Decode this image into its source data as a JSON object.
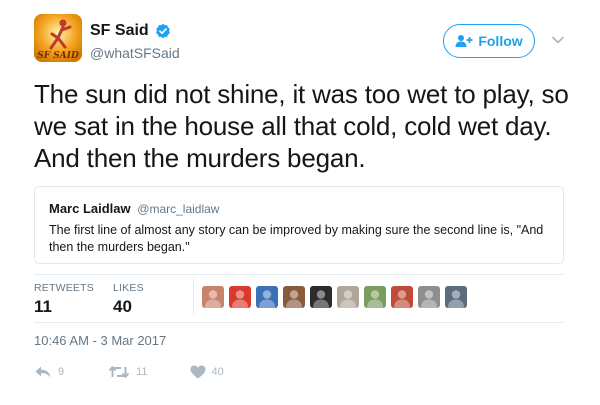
{
  "author": {
    "name": "SF Said",
    "handle": "@whatSFSaid",
    "avatar_text": "SF SAID"
  },
  "follow_button": {
    "label": "Follow"
  },
  "tweet": {
    "text": "The sun did not shine, it was too wet to play, so\nwe sat in the house all that cold, cold wet day.\nAnd then the murders began."
  },
  "quoted_tweet": {
    "author_name": "Marc Laidlaw",
    "author_handle": "@marc_laidlaw",
    "text": "The first line of almost any story can be improved by making sure the second line is, \"And then the murders began.\""
  },
  "stats": {
    "retweets_label": "RETWEETS",
    "retweets_value": "11",
    "likes_label": "LIKES",
    "likes_value": "40"
  },
  "likers": [
    {
      "name": "liker-1-avatar",
      "color": "#c9836b"
    },
    {
      "name": "liker-2-avatar",
      "color": "#d93a2b"
    },
    {
      "name": "liker-3-avatar",
      "color": "#3b6fb6"
    },
    {
      "name": "liker-4-avatar",
      "color": "#8a5a3c"
    },
    {
      "name": "liker-5-avatar",
      "color": "#2c2c2c"
    },
    {
      "name": "liker-6-avatar",
      "color": "#b0a79c"
    },
    {
      "name": "liker-7-avatar",
      "color": "#7a9c5e"
    },
    {
      "name": "liker-8-avatar",
      "color": "#c04b3a"
    },
    {
      "name": "liker-9-avatar",
      "color": "#8e8e8e"
    },
    {
      "name": "liker-10-avatar",
      "color": "#5d6d7e"
    }
  ],
  "timestamp": "10:46 AM - 3 Mar 2017",
  "actions": {
    "reply_count": "9",
    "retweet_count": "11",
    "like_count": "40"
  },
  "colors": {
    "accent": "#1da1f2",
    "muted": "#657786",
    "action_gray": "#aab8c2"
  },
  "icons": {
    "verified": "verified-badge-icon",
    "follow": "add-person-icon",
    "caret": "chevron-down-icon",
    "reply": "reply-icon",
    "retweet": "retweet-icon",
    "like": "heart-icon"
  }
}
